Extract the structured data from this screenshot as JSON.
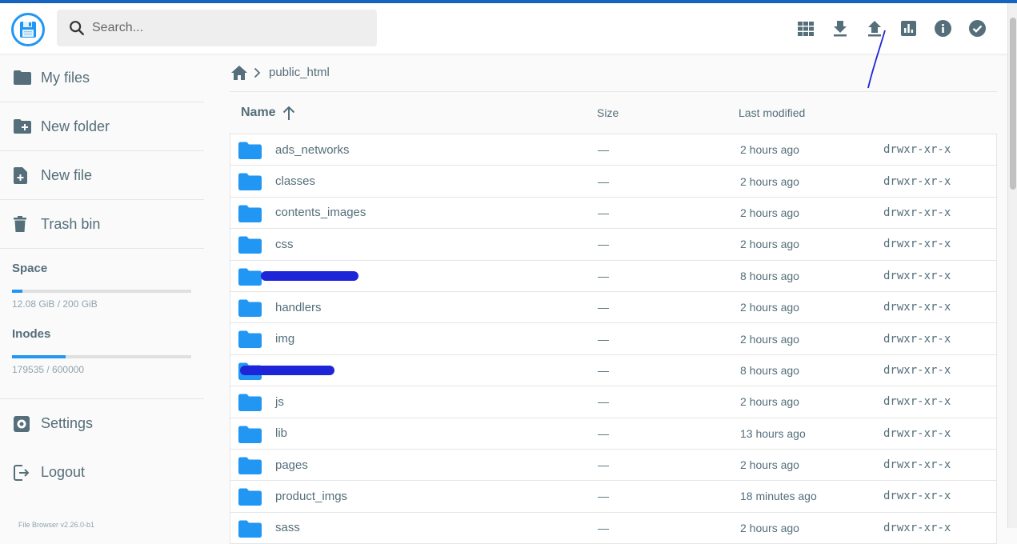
{
  "app": {
    "version": "File Browser v2.26.0-b1"
  },
  "search": {
    "placeholder": "Search..."
  },
  "toolbar": {
    "actions": [
      {
        "name": "grid-view-icon"
      },
      {
        "name": "download-icon"
      },
      {
        "name": "upload-icon"
      },
      {
        "name": "chart-icon"
      },
      {
        "name": "info-icon"
      },
      {
        "name": "check-circle-icon"
      }
    ]
  },
  "sidebar": {
    "my_files": "My files",
    "new_folder": "New folder",
    "new_file": "New file",
    "trash": "Trash bin",
    "settings": "Settings",
    "logout": "Logout"
  },
  "quota": {
    "space_label": "Space",
    "space_value": "12.08 GiB / 200 GiB",
    "space_fraction": 0.06,
    "inodes_label": "Inodes",
    "inodes_value": "179535 / 600000",
    "inodes_fraction": 0.3
  },
  "breadcrumb": {
    "current": "public_html"
  },
  "table": {
    "headers": {
      "name": "Name",
      "size": "Size",
      "modified": "Last modified"
    },
    "rows": [
      {
        "name": "ads_networks",
        "size": "—",
        "modified": "2 hours ago",
        "perm": "drwxr-xr-x"
      },
      {
        "name": "classes",
        "size": "—",
        "modified": "2 hours ago",
        "perm": "drwxr-xr-x"
      },
      {
        "name": "contents_images",
        "size": "—",
        "modified": "2 hours ago",
        "perm": "drwxr-xr-x"
      },
      {
        "name": "css",
        "size": "—",
        "modified": "2 hours ago",
        "perm": "drwxr-xr-x"
      },
      {
        "name": "",
        "size": "—",
        "modified": "8 hours ago",
        "perm": "drwxr-xr-x"
      },
      {
        "name": "handlers",
        "size": "—",
        "modified": "2 hours ago",
        "perm": "drwxr-xr-x"
      },
      {
        "name": "img",
        "size": "—",
        "modified": "2 hours ago",
        "perm": "drwxr-xr-x"
      },
      {
        "name": "",
        "size": "—",
        "modified": "8 hours ago",
        "perm": "drwxr-xr-x"
      },
      {
        "name": "js",
        "size": "—",
        "modified": "2 hours ago",
        "perm": "drwxr-xr-x"
      },
      {
        "name": "lib",
        "size": "—",
        "modified": "13 hours ago",
        "perm": "drwxr-xr-x"
      },
      {
        "name": "pages",
        "size": "—",
        "modified": "2 hours ago",
        "perm": "drwxr-xr-x"
      },
      {
        "name": "product_imgs",
        "size": "—",
        "modified": "18 minutes ago",
        "perm": "drwxr-xr-x"
      },
      {
        "name": "sass",
        "size": "—",
        "modified": "2 hours ago",
        "perm": "drwxr-xr-x"
      }
    ]
  },
  "colors": {
    "accent": "#2196f3",
    "topline": "#1565c0",
    "text": "#546e7a",
    "redaction": "#1e25d8"
  }
}
